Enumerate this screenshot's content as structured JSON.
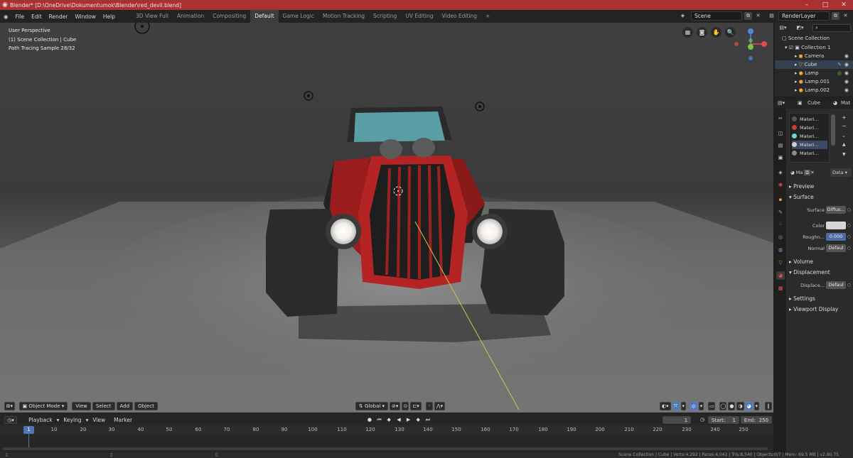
{
  "window": {
    "title": "Blender* [D:\\OneDrive\\Dokumentumok\\Blender\\red_devil.blend]",
    "controls": [
      "–",
      "□",
      "✕"
    ]
  },
  "menu": [
    "File",
    "Edit",
    "Render",
    "Window",
    "Help"
  ],
  "workspaces": [
    "3D View Full",
    "Animation",
    "Compositing",
    "Default",
    "Game Logic",
    "Motion Tracking",
    "Scripting",
    "UV Editing",
    "Video Editing",
    "+"
  ],
  "active_workspace": "Default",
  "scene_field": "Scene",
  "render_layer_field": "RenderLayer",
  "viewport": {
    "info_lines": [
      "User Perspective",
      "(1) Scene Collection | Cube",
      "Path Tracing Sample 28/32"
    ],
    "nav_icons": [
      "grid-icon",
      "camera-icon",
      "hand-icon",
      "zoom-icon"
    ],
    "nav_glyphs": [
      "▦",
      "◙",
      "✋",
      "🔍"
    ],
    "gizmo_colors": {
      "x": "#e84a4a",
      "y": "#7ec34a",
      "z": "#4a8ad8"
    },
    "header": {
      "mode": "Object Mode",
      "menus": [
        "View",
        "Select",
        "Add",
        "Object"
      ],
      "orientation": "Global"
    }
  },
  "timeline": {
    "menus": [
      "Playback",
      "Keying",
      "View",
      "Marker"
    ],
    "current_frame": "1",
    "start_label": "Start:",
    "start": "1",
    "end_label": "End:",
    "end": "250",
    "ruler_ticks": [
      "10",
      "20",
      "30",
      "40",
      "50",
      "60",
      "70",
      "80",
      "90",
      "100",
      "110",
      "120",
      "130",
      "140",
      "150",
      "160",
      "170",
      "180",
      "190",
      "200",
      "210",
      "220",
      "230",
      "240",
      "250"
    ]
  },
  "status_bar": {
    "info": "Scene Collection | Cube | Verts:4,292 | Faces:4,042 | Tris:8,540 | Objects:0/7 | Mem: 69.5 MB | v2.80.75"
  },
  "outliner": {
    "root": "Scene Collection",
    "items": [
      {
        "name": "Collection 1",
        "icon": "collection-icon",
        "glyph": "▣"
      },
      {
        "name": "Camera",
        "icon": "camera-object-icon",
        "glyph": "◼"
      },
      {
        "name": "Cube",
        "icon": "mesh-icon",
        "glyph": "▽"
      },
      {
        "name": "Lamp",
        "icon": "light-icon",
        "glyph": "●"
      },
      {
        "name": "Lamp.001",
        "icon": "light-icon",
        "glyph": "●"
      },
      {
        "name": "Lamp.002",
        "icon": "light-icon",
        "glyph": "●"
      }
    ]
  },
  "properties": {
    "object_name": "Cube",
    "tab_label": "Mat",
    "material_slots": [
      {
        "name": "Materi...",
        "color": "#555555"
      },
      {
        "name": "Materi...",
        "color": "#d23a3a"
      },
      {
        "name": "Materi...",
        "color": "#6fd3de"
      },
      {
        "name": "Materi...",
        "color": "#cfcfcf"
      },
      {
        "name": "Materi...",
        "color": "#8a8a8a"
      }
    ],
    "material_name": "Ma",
    "data_dropdown": "Data",
    "sections": {
      "preview": "Preview",
      "surface": "Surface",
      "volume": "Volume",
      "displacement": "Displacement",
      "settings": "Settings",
      "viewport_display": "Viewport Display"
    },
    "surface_fields": [
      {
        "label": "Surface",
        "value": "Diffus..."
      },
      {
        "label": "Color",
        "value": ""
      },
      {
        "label": "Roughn...",
        "value": "0.000"
      },
      {
        "label": "Normal",
        "value": "Defaul"
      }
    ],
    "displacement_field": {
      "label": "Displace...",
      "value": "Defaul"
    },
    "color_swatch": "#d6d6d6"
  }
}
